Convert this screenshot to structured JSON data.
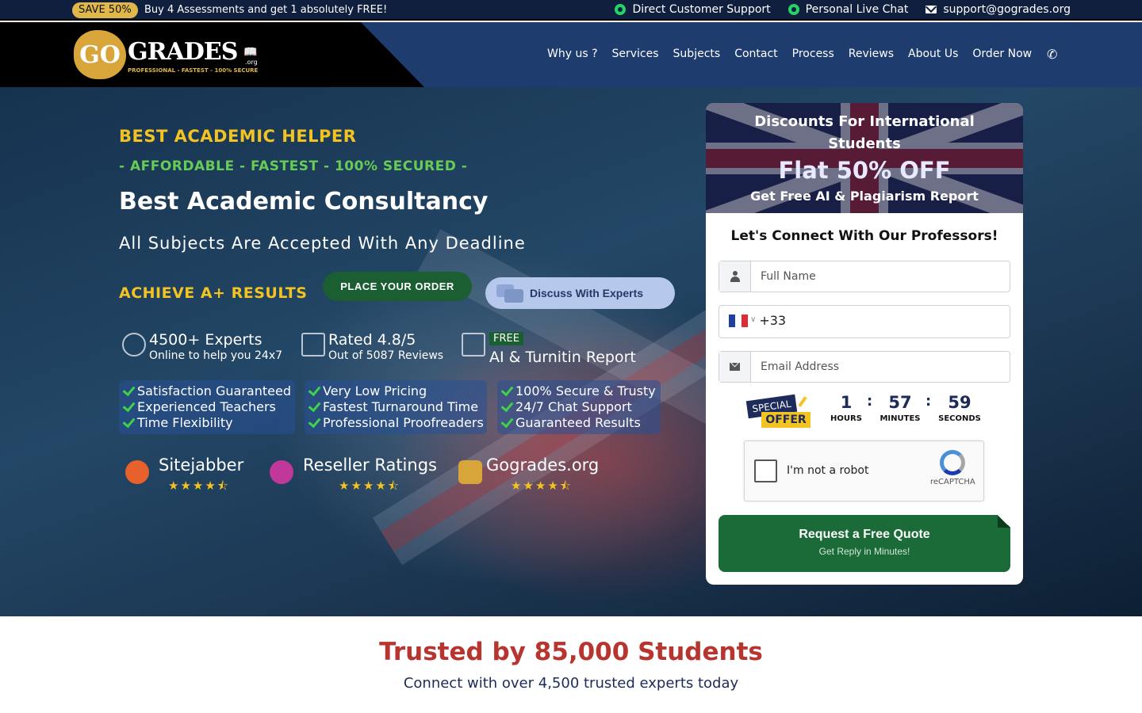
{
  "topbar": {
    "save_badge": "SAVE 50%",
    "promo": "Buy 4 Assessments and get 1 absolutely FREE!",
    "links": [
      {
        "label": "Direct Customer Support",
        "icon": "whatsapp-icon"
      },
      {
        "label": "Personal Live Chat",
        "icon": "whatsapp-icon"
      },
      {
        "label": "support@gogrades.org",
        "icon": "mail-icon"
      }
    ]
  },
  "header": {
    "logo": {
      "go": "GO",
      "grades": "GRADES",
      "org": ".org",
      "tagline": "PROFESSIONAL - FASTEST - 100% SECURE"
    },
    "nav": [
      "Why us ?",
      "Services",
      "Subjects",
      "Contact",
      "Process",
      "Reviews",
      "About Us",
      "Order Now"
    ],
    "phone_icon": "phone-icon"
  },
  "hero": {
    "eyebrow": "BEST ACADEMIC HELPER",
    "tagline": "- AFFORDABLE - FASTEST - 100% SECURED -",
    "title": "Best Academic Consultancy",
    "subtitle": "All Subjects Are Accepted With Any Deadline",
    "achieve": "ACHIEVE A+ RESULTS",
    "order_button": "PLACE YOUR ORDER",
    "discuss_button": "Discuss With Experts",
    "stats": [
      {
        "title": "4500+ Experts",
        "sub": "Online to help you 24x7"
      },
      {
        "title": "Rated 4.8/5",
        "sub": "Out of 5087 Reviews"
      },
      {
        "badge": "FREE",
        "title": "AI & Turnitin Report"
      }
    ],
    "features": [
      [
        "Satisfaction Guaranteed",
        "Experienced Teachers",
        "Time Flexibility"
      ],
      [
        "Very Low Pricing",
        "Fastest Turnaround Time",
        "Professional Proofreaders"
      ],
      [
        "100% Secure & Trusty",
        "24/7 Chat Support",
        "Guaranteed Results"
      ]
    ],
    "ratings": [
      {
        "name": "Sitejabber",
        "stars": 4.5
      },
      {
        "name": "Reseller Ratings",
        "stars": 4.5
      },
      {
        "name": "Gogrades.org",
        "stars": 4.5
      }
    ]
  },
  "form": {
    "banner_title": "Discounts For International Students",
    "banner_offer": "Flat 50% OFF",
    "banner_sub": "Get Free AI & Plagiarism Report",
    "title": "Let's Connect With Our Professors!",
    "name_placeholder": "Full Name",
    "phone_code": "+33",
    "email_placeholder": "Email Address",
    "special_top": "SPECIAL",
    "special_bottom": "OFFER",
    "timer": {
      "hours": "1",
      "minutes": "57",
      "seconds": "59",
      "hours_label": "HOURS",
      "minutes_label": "MINUTES",
      "seconds_label": "SECONDS"
    },
    "recaptcha_text": "I'm not a robot",
    "recaptcha_brand": "reCAPTCHA",
    "submit_main": "Request a Free Quote",
    "submit_sub": "Get Reply in Minutes!"
  },
  "trusted": {
    "title": "Trusted by 85,000 Students",
    "subtitle": "Connect with over 4,500 trusted experts today"
  },
  "colors": {
    "accent_yellow": "#f3c322",
    "accent_green": "#66cc55",
    "navy": "#1d2b5a",
    "cta_green": "#1b6b38",
    "trusted_red": "#b8352f"
  }
}
